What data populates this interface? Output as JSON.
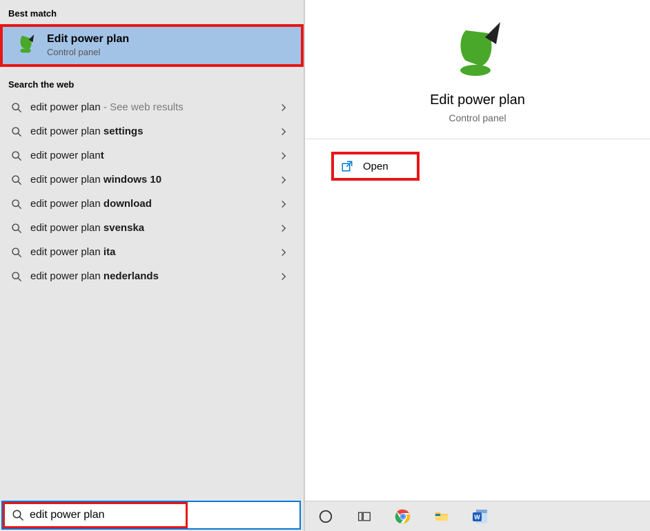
{
  "left": {
    "best_match_header": "Best match",
    "best_match": {
      "title": "Edit power plan",
      "subtitle": "Control panel"
    },
    "search_web_header": "Search the web",
    "web_items": [
      {
        "prefix": "edit power plan",
        "bold": "",
        "extra": " - See web results"
      },
      {
        "prefix": "edit power plan ",
        "bold": "settings",
        "extra": ""
      },
      {
        "prefix": "edit power plan",
        "bold": "t",
        "extra": ""
      },
      {
        "prefix": "edit power plan ",
        "bold": "windows 10",
        "extra": ""
      },
      {
        "prefix": "edit power plan ",
        "bold": "download",
        "extra": ""
      },
      {
        "prefix": "edit power plan ",
        "bold": "svenska",
        "extra": ""
      },
      {
        "prefix": "edit power plan ",
        "bold": "ita",
        "extra": ""
      },
      {
        "prefix": "edit power plan ",
        "bold": "nederlands",
        "extra": ""
      }
    ],
    "search_value": "edit power plan"
  },
  "right": {
    "title": "Edit power plan",
    "subtitle": "Control panel",
    "action_open": "Open"
  },
  "highlight_color": "#e61717"
}
